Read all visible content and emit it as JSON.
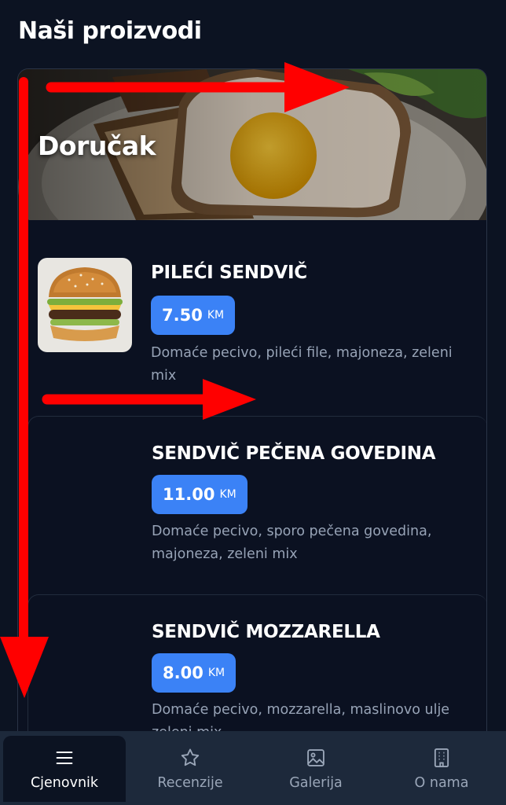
{
  "page": {
    "title": "Naši proizvodi"
  },
  "category": {
    "title": "Doručak"
  },
  "items": [
    {
      "name": "PILEĆI SENDVIČ",
      "price": "7.50",
      "currency": "KM",
      "description": "Domaće pecivo, pileći file, majoneza, zeleni mix"
    },
    {
      "name": "SENDVIČ PEČENA GOVEDINA",
      "price": "11.00",
      "currency": "KM",
      "description": "Domaće pecivo, sporo pečena govedina, majoneza, zeleni mix"
    },
    {
      "name": "SENDVIČ MOZZARELLA",
      "price": "8.00",
      "currency": "KM",
      "description": "Domaće pecivo, mozzarella, maslinovo ulje zeleni mix"
    }
  ],
  "nav": [
    {
      "label": "Cjenovnik",
      "icon": "menu-icon",
      "active": true
    },
    {
      "label": "Recenzije",
      "icon": "star-icon",
      "active": false
    },
    {
      "label": "Galerija",
      "icon": "image-icon",
      "active": false
    },
    {
      "label": "O nama",
      "icon": "building-icon",
      "active": false
    }
  ],
  "colors": {
    "background": "#0c1322",
    "accent": "#3b82f6",
    "nav_bg": "#1d293b",
    "annotation": "#ff0000"
  }
}
